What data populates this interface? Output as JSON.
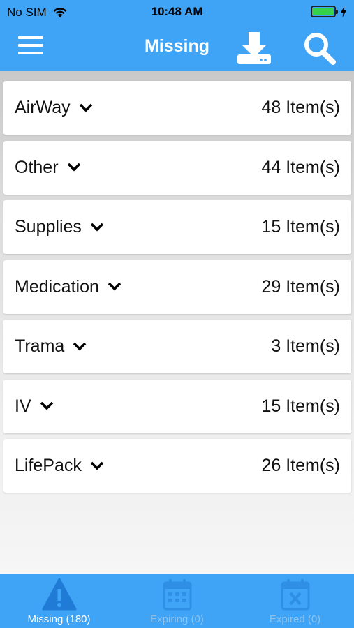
{
  "status_bar": {
    "carrier": "No SIM",
    "time": "10:48 AM"
  },
  "nav": {
    "title": "Missing",
    "icons": [
      "menu-icon",
      "download-icon",
      "search-icon"
    ]
  },
  "categories": [
    {
      "name": "AirWay",
      "count": "48 Item(s)"
    },
    {
      "name": "Other",
      "count": "44 Item(s)"
    },
    {
      "name": "Supplies",
      "count": "15 Item(s)"
    },
    {
      "name": "Medication",
      "count": "29 Item(s)"
    },
    {
      "name": "Trama",
      "count": "3 Item(s)"
    },
    {
      "name": "IV",
      "count": "15 Item(s)"
    },
    {
      "name": "LifePack",
      "count": "26 Item(s)"
    }
  ],
  "tabs": [
    {
      "label": "Missing (180)",
      "icon": "warning-icon",
      "active": true
    },
    {
      "label": "Expiring (0)",
      "icon": "calendar-icon",
      "active": false
    },
    {
      "label": "Expired (0)",
      "icon": "calendar-x-icon",
      "active": false
    }
  ],
  "colors": {
    "primary": "#3fa4f6",
    "inactive_tab": "#8dc3f0",
    "battery": "#36d14a"
  }
}
